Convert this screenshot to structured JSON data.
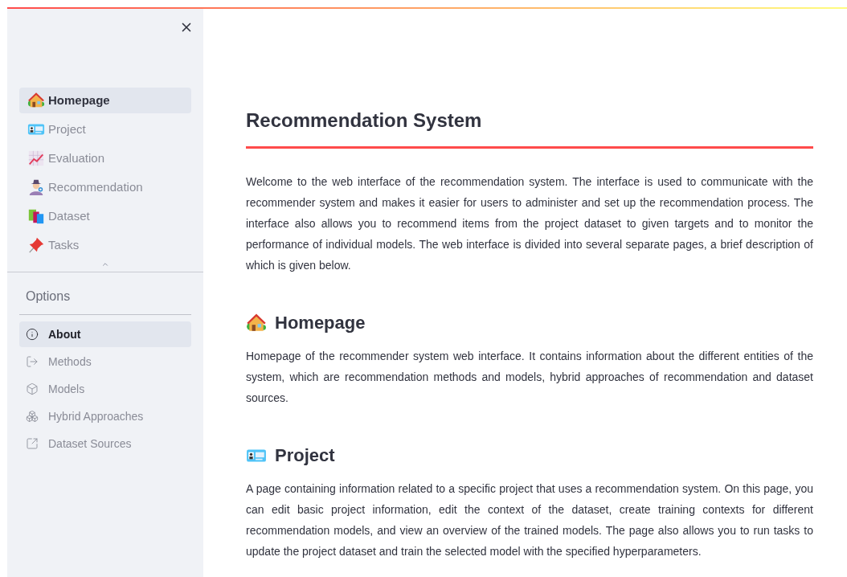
{
  "sidebar": {
    "pages": [
      {
        "label": "Homepage",
        "selected": true
      },
      {
        "label": "Project",
        "selected": false
      },
      {
        "label": "Evaluation",
        "selected": false
      },
      {
        "label": "Recommendation",
        "selected": false
      },
      {
        "label": "Dataset",
        "selected": false
      },
      {
        "label": "Tasks",
        "selected": false
      }
    ],
    "options": {
      "title": "Options",
      "items": [
        {
          "label": "About",
          "selected": true
        },
        {
          "label": "Methods",
          "selected": false
        },
        {
          "label": "Models",
          "selected": false
        },
        {
          "label": "Hybrid Approaches",
          "selected": false
        },
        {
          "label": "Dataset Sources",
          "selected": false
        }
      ]
    }
  },
  "main": {
    "title": "Recommendation System",
    "intro": "Welcome to the web interface of the recommendation system. The interface is used to communicate with the recommender system and makes it easier for users to administer and set up the recommendation process. The interface also allows you to recommend items from the project dataset to given targets and to monitor the performance of individual models. The web interface is divided into several separate pages, a brief description of which is given below.",
    "sections": [
      {
        "heading": "Homepage",
        "text": "Homepage of the recommender system web interface. It contains information about the different entities of the system, which are recommendation methods and models, hybrid approaches of recommendation and dataset sources."
      },
      {
        "heading": "Project",
        "text": "A page containing information related to a specific project that uses a recommendation system. On this page, you can edit basic project information, edit the context of the dataset, create training contexts for different recommendation models, and view an overview of the trained models. The page also allows you to run tasks to update the project dataset and train the selected model with the specified hyperparameters."
      }
    ]
  }
}
